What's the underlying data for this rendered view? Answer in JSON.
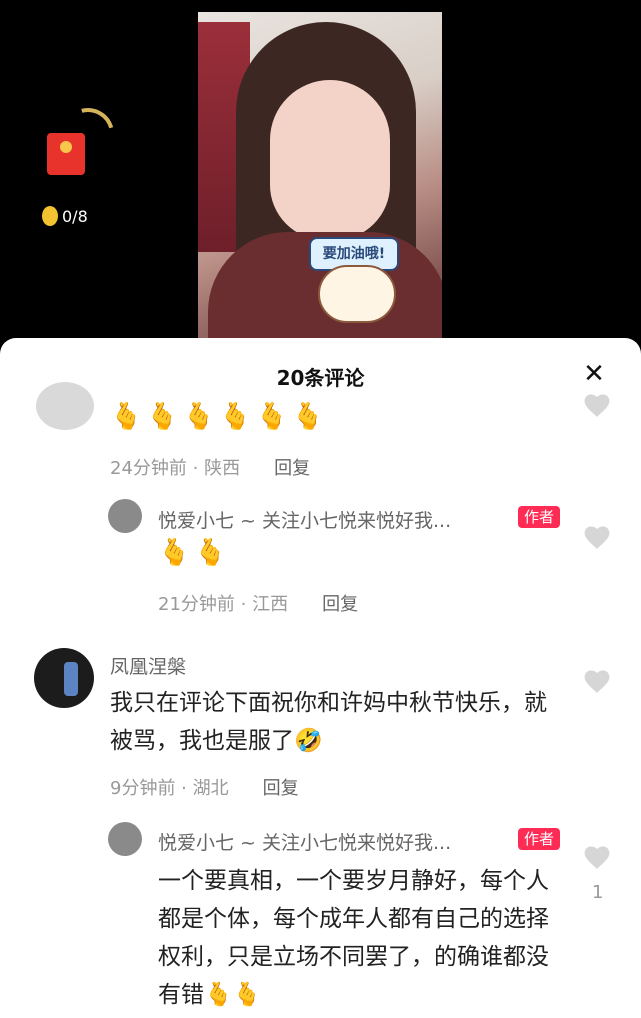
{
  "video": {
    "sticker_text": "要加油哦!",
    "coin_progress": "0/8"
  },
  "comments_header": {
    "title": "20条评论",
    "close_glyph": "✕"
  },
  "comments": [
    {
      "content": "🫰🫰🫰🫰🫰🫰",
      "meta_time_loc": "24分钟前 · 陕西",
      "reply_label": "回复"
    },
    {
      "username": "悦爱小七 ~ 关注小七悦来悦好我...",
      "author_tag": "作者",
      "content": "🫰🫰",
      "meta_time_loc": "21分钟前 · 江西",
      "reply_label": "回复"
    },
    {
      "username": "凤凰涅槃",
      "content": "我只在评论下面祝你和许妈中秋节快乐，就被骂，我也是服了🤣",
      "meta_time_loc": "9分钟前 · 湖北",
      "reply_label": "回复"
    },
    {
      "username": "悦爱小七 ~ 关注小七悦来悦好我...",
      "author_tag": "作者",
      "content": "一个要真相，一个要岁月静好，每个人都是个体，每个成年人都有自己的选择权利，只是立场不同罢了，的确谁都没有错🫰🫰",
      "like_count": "1"
    }
  ]
}
